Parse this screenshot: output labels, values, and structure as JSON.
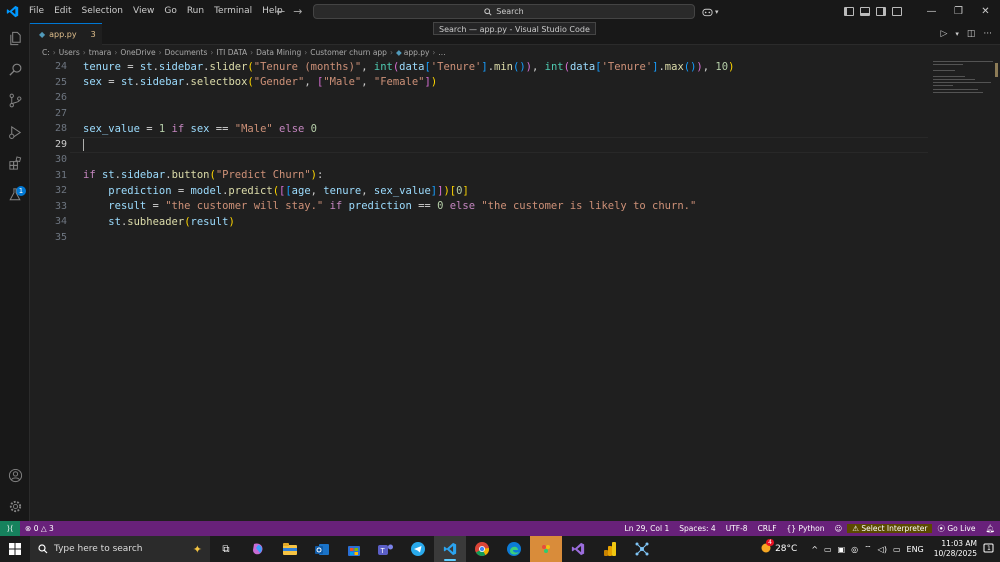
{
  "titlebar": {
    "menu": [
      "File",
      "Edit",
      "Selection",
      "View",
      "Go",
      "Run",
      "Terminal",
      "Help"
    ],
    "search": "Search",
    "tooltip": "Search — app.py - Visual Studio Code"
  },
  "tab": {
    "name": "app.py",
    "problems": "3"
  },
  "breadcrumb": [
    "C:",
    "Users",
    "tmara",
    "OneDrive",
    "Documents",
    "ITI DATA",
    "Data Mining",
    "Customer churn app",
    "app.py",
    "..."
  ],
  "editor": {
    "line_numbers": [
      "24",
      "25",
      "26",
      "27",
      "28",
      "29",
      "30",
      "31",
      "32",
      "33",
      "34",
      "35"
    ],
    "current_line": "29"
  },
  "statusbar": {
    "problems_errors": "0",
    "problems_warnings": "3",
    "position": "Ln 29, Col 1",
    "spaces": "Spaces: 4",
    "encoding": "UTF-8",
    "eol": "CRLF",
    "language": "Python",
    "interpreter": "Select Interpreter",
    "golive": "Go Live"
  },
  "taskbar": {
    "search_placeholder": "Type here to search",
    "temperature": "28°C",
    "lang": "ENG",
    "time": "11:03 AM",
    "date": "10/28/2025",
    "weather_badge": "4",
    "notification_count": "1"
  },
  "colors": {
    "accent": "#0078d4",
    "status": "#68217a",
    "remote": "#16825d"
  }
}
